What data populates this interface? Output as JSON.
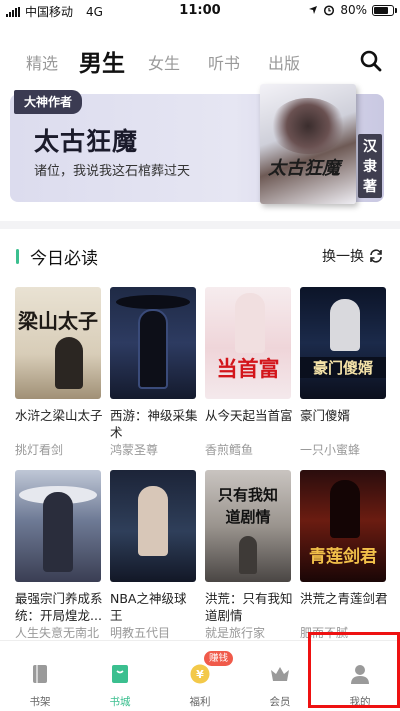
{
  "status_bar": {
    "carrier": "中国移动",
    "network": "4G",
    "time": "11:00",
    "battery": "80%",
    "battery_level": 0.8
  },
  "tabs": [
    {
      "label": "精选",
      "active": false
    },
    {
      "label": "男生",
      "active": true
    },
    {
      "label": "女生",
      "active": false
    },
    {
      "label": "听书",
      "active": false
    },
    {
      "label": "出版",
      "active": false
    }
  ],
  "icons": {
    "search": "search-icon",
    "refresh": "refresh-icon"
  },
  "banner": {
    "tag": "大神作者",
    "title": "太古狂魔",
    "subtitle": "诸位，我说我这石棺葬过天",
    "cover_title": "太古狂魔",
    "author": "汉隶著"
  },
  "section": {
    "title": "今日必读",
    "refresh_label": "换一换"
  },
  "books": [
    {
      "title": "水浒之梁山太子",
      "author": "挑灯看剑",
      "cover_text": "梁山太子"
    },
    {
      "title": "西游：神级采集术",
      "author": "鸿蒙圣尊",
      "cover_text": ""
    },
    {
      "title": "从今天起当首富",
      "author": "香煎鳕鱼",
      "cover_text": "当首富"
    },
    {
      "title": "豪门傻婿",
      "author": "一只小蜜蜂",
      "cover_text": "豪门傻婿"
    },
    {
      "title": "最强宗门养成系统：开局煌龙...",
      "author": "人生失意无南北",
      "cover_text": ""
    },
    {
      "title": "NBA之神级球王",
      "author": "明教五代目",
      "cover_text": ""
    },
    {
      "title": "洪荒：只有我知道剧情",
      "author": "就是旅行家",
      "cover_text": "只有我知道剧情"
    },
    {
      "title": "洪荒之青莲剑君",
      "author": "肥而不腻",
      "cover_text": "青莲剑君"
    }
  ],
  "bottom_nav": [
    {
      "label": "书架",
      "icon": "bookshelf-icon",
      "active": false
    },
    {
      "label": "书城",
      "icon": "bookstore-icon",
      "active": true
    },
    {
      "label": "福利",
      "icon": "welfare-coin-icon",
      "active": false,
      "badge": "赚钱"
    },
    {
      "label": "会员",
      "icon": "crown-icon",
      "active": false
    },
    {
      "label": "我的",
      "icon": "profile-icon",
      "active": false
    }
  ],
  "colors": {
    "accent": "#3bbf8f",
    "badge": "#f05a4a",
    "highlight": "#ee1111"
  }
}
